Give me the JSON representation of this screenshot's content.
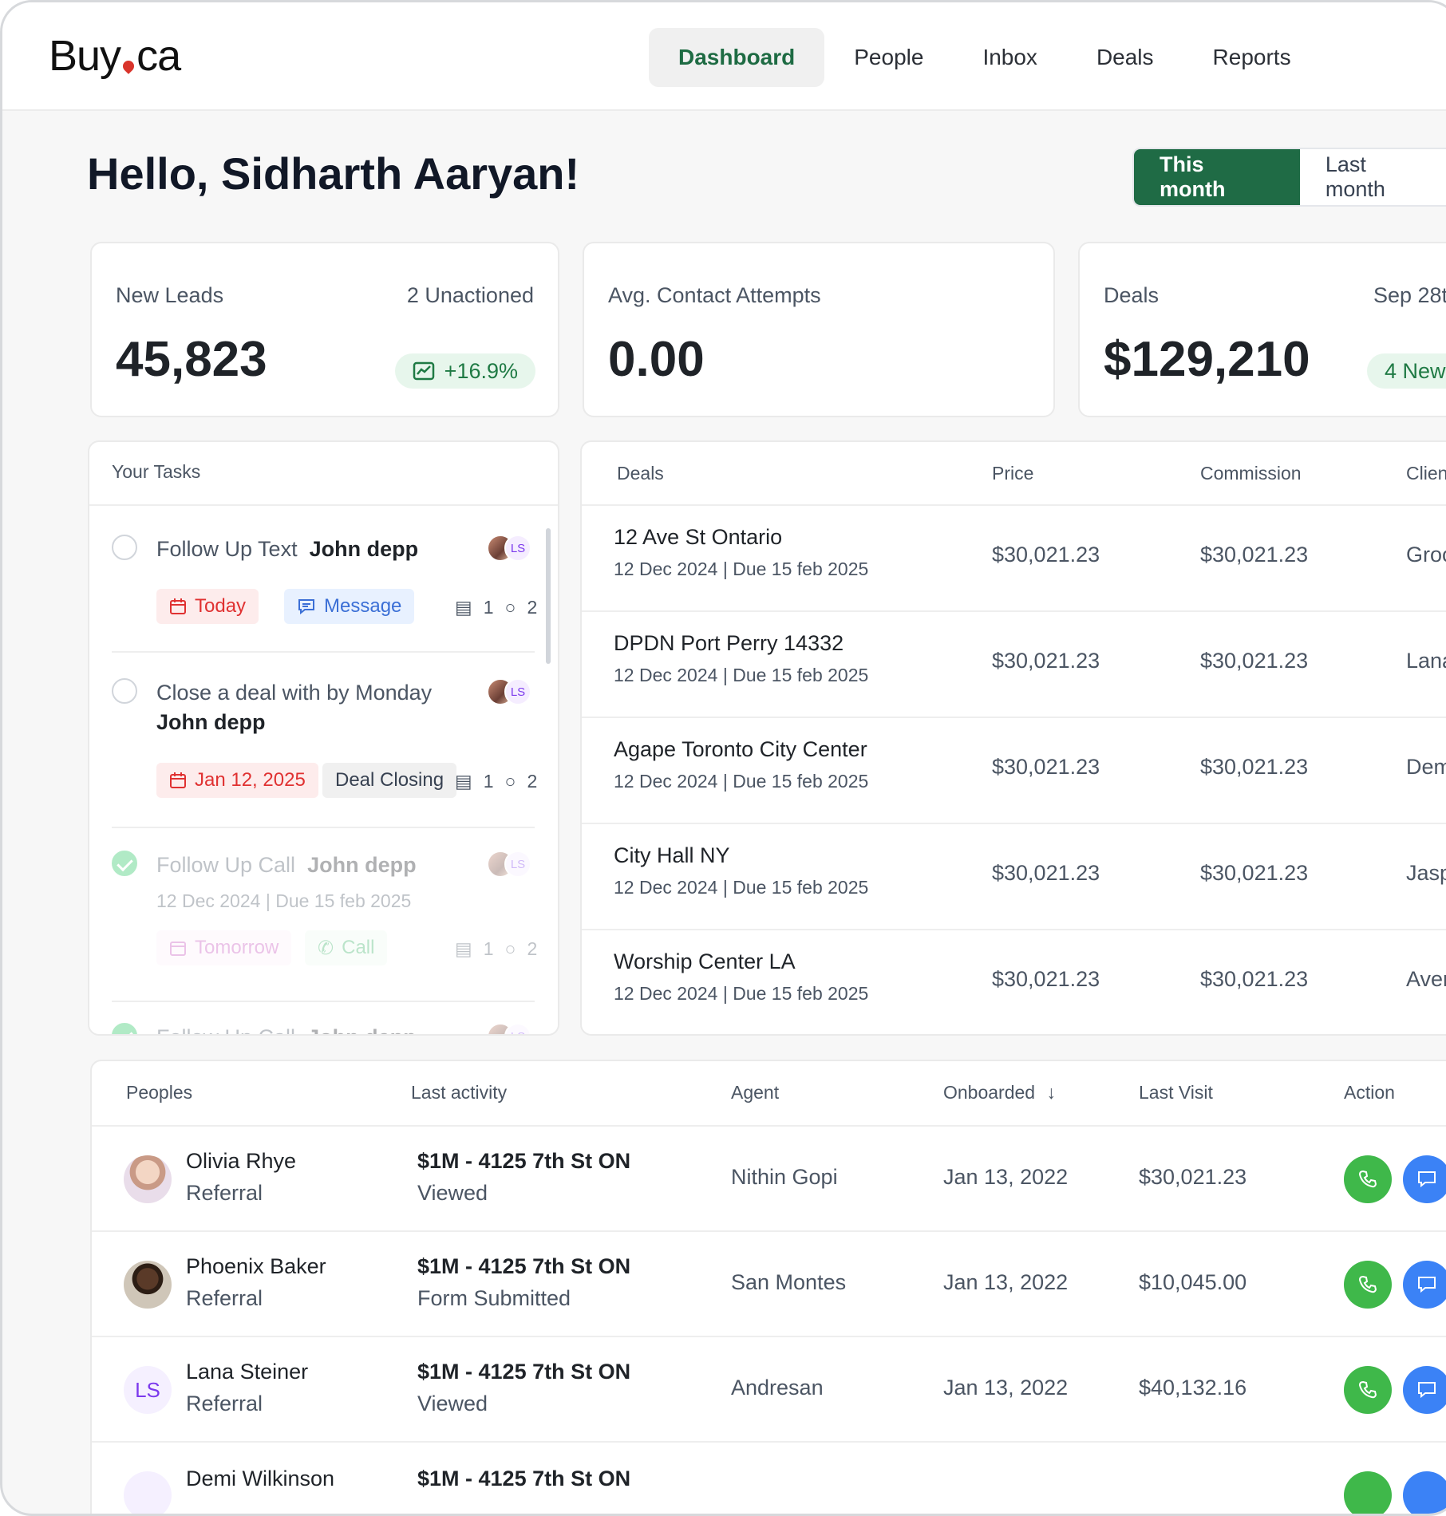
{
  "brand": {
    "name_left": "Buy",
    "name_right": "ca"
  },
  "nav": [
    "Dashboard",
    "People",
    "Inbox",
    "Deals",
    "Reports"
  ],
  "greeting": "Hello, Sidharth Aaryan!",
  "period": {
    "active": "This month",
    "other": "Last month"
  },
  "stats": {
    "leads": {
      "label": "New Leads",
      "side": "2 Unactioned",
      "value": "45,823",
      "badge": "+16.9%"
    },
    "contact": {
      "label": "Avg. Contact Attempts",
      "value": "0.00"
    },
    "deals": {
      "label": "Deals",
      "side": "Sep 28t",
      "value": "$129,210",
      "badge": "4 New"
    }
  },
  "tasks": {
    "title": "Your Tasks",
    "items": [
      {
        "prefix": "Follow Up Text",
        "name": "John depp",
        "chip1": "Today",
        "chip2": "Message",
        "notes": "1",
        "comments": "2",
        "avatar": "LS"
      },
      {
        "prefix": "Close a deal with by Monday",
        "name": "John depp",
        "chip1": "Jan 12, 2025",
        "chip2": "Deal Closing",
        "notes": "1",
        "comments": "2",
        "avatar": "LS"
      },
      {
        "prefix": "Follow Up Call",
        "name": "John depp",
        "date": "12 Dec 2024",
        "due": "Due 15 feb 2025",
        "chip1": "Tomorrow",
        "chip2": "Call",
        "notes": "1",
        "comments": "2",
        "avatar": "LS"
      },
      {
        "prefix": "Follow Up Call",
        "name": "John depp",
        "avatar": "LS"
      }
    ]
  },
  "deals_table": {
    "headers": [
      "Deals",
      "Price",
      "Commission",
      "Clien"
    ],
    "rows": [
      {
        "name": "12 Ave St Ontario",
        "date": "12 Dec 2024",
        "due": "Due 15 feb 2025",
        "price": "$30,021.23",
        "commission": "$30,021.23",
        "client": "Groc"
      },
      {
        "name": "DPDN Port Perry 14332",
        "date": "12 Dec 2024",
        "due": "Due 15 feb 2025",
        "price": "$30,021.23",
        "commission": "$30,021.23",
        "client": "Lana"
      },
      {
        "name": "Agape Toronto City Center",
        "date": "12 Dec 2024",
        "due": "Due 15 feb 2025",
        "price": "$30,021.23",
        "commission": "$30,021.23",
        "client": "Dem"
      },
      {
        "name": "City Hall NY",
        "date": "12 Dec 2024",
        "due": "Due 15 feb 2025",
        "price": "$30,021.23",
        "commission": "$30,021.23",
        "client": "Jasp"
      },
      {
        "name": "Worship Center LA",
        "date": "12 Dec 2024",
        "due": "Due 15 feb 2025",
        "price": "$30,021.23",
        "commission": "$30,021.23",
        "client": "Aver"
      }
    ]
  },
  "people_table": {
    "headers": [
      "Peoples",
      "Last activity",
      "Agent",
      "Onboarded",
      "Last Visit",
      "Action"
    ],
    "rows": [
      {
        "name": "Olivia Rhye",
        "source": "Referral",
        "activity": "$1M - 4125 7th St ON",
        "activity_sub": "Viewed",
        "agent": "Nithin Gopi",
        "onboarded": "Jan 13, 2022",
        "visit": "$30,021.23"
      },
      {
        "name": "Phoenix Baker",
        "source": "Referral",
        "activity": "$1M - 4125 7th St ON",
        "activity_sub": "Form Submitted",
        "agent": "San Montes",
        "onboarded": "Jan 13, 2022",
        "visit": "$10,045.00"
      },
      {
        "name": "Lana Steiner",
        "initials": "LS",
        "source": "Referral",
        "activity": "$1M - 4125 7th St ON",
        "activity_sub": "Viewed",
        "agent": "Andresan",
        "onboarded": "Jan 13, 2022",
        "visit": "$40,132.16"
      },
      {
        "name": "Demi Wilkinson",
        "activity": "$1M - 4125 7th St ON"
      }
    ]
  }
}
